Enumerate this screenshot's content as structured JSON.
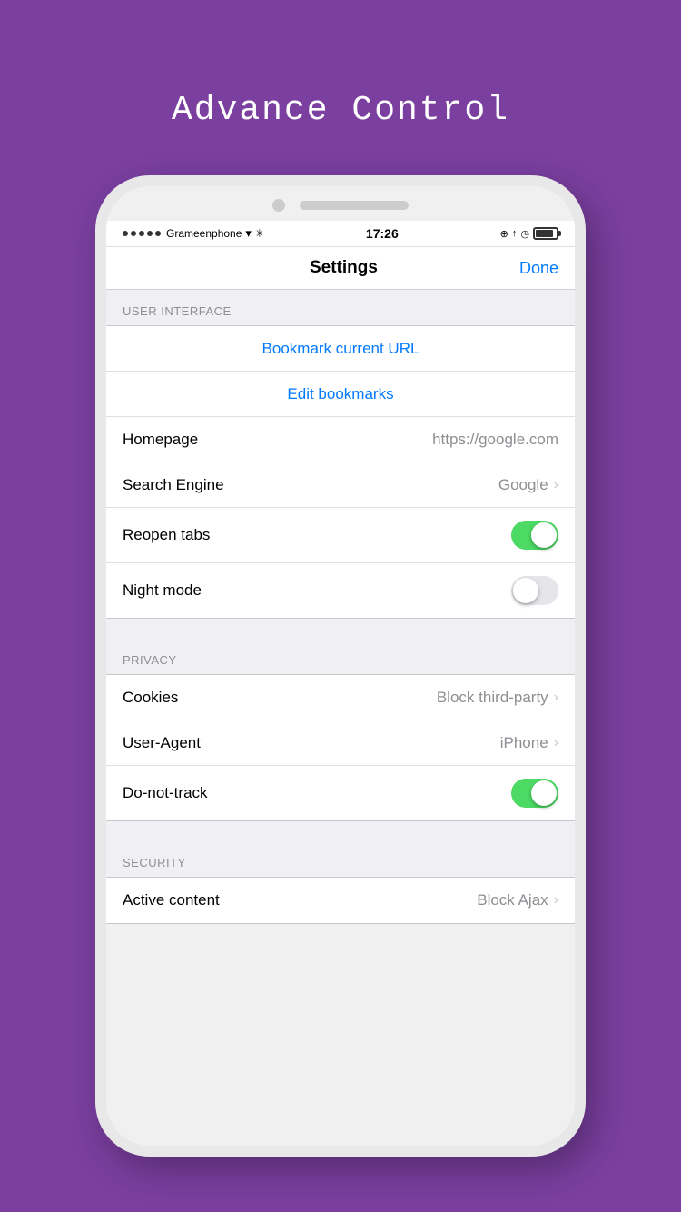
{
  "page": {
    "background_color": "#7B3FA0",
    "title": "Advance Control"
  },
  "status_bar": {
    "carrier": "Grameenphone",
    "time": "17:26",
    "signal_dots": 5
  },
  "nav": {
    "title": "Settings",
    "done_label": "Done"
  },
  "sections": {
    "user_interface": {
      "header": "USER INTERFACE",
      "bookmark_current_url": "Bookmark current URL",
      "edit_bookmarks": "Edit bookmarks",
      "homepage_label": "Homepage",
      "homepage_value": "https://google.com",
      "search_engine_label": "Search Engine",
      "search_engine_value": "Google",
      "reopen_tabs_label": "Reopen tabs",
      "reopen_tabs_on": true,
      "night_mode_label": "Night mode",
      "night_mode_on": false
    },
    "privacy": {
      "header": "PRIVACY",
      "cookies_label": "Cookies",
      "cookies_value": "Block third-party",
      "user_agent_label": "User-Agent",
      "user_agent_value": "iPhone",
      "do_not_track_label": "Do-not-track",
      "do_not_track_on": true
    },
    "security": {
      "header": "SECURITY",
      "active_content_label": "Active content",
      "active_content_value": "Block Ajax"
    }
  }
}
